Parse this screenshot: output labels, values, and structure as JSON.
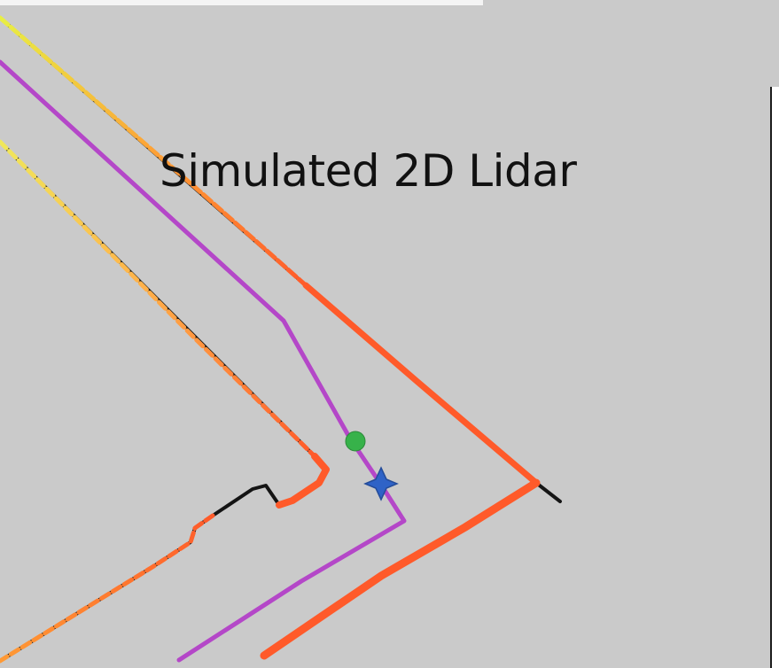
{
  "title": "Simulated 2D Lidar",
  "colors": {
    "background": "#cacaca",
    "wall": "#111111",
    "scan_near": "#ff5a2a",
    "scan_mid": "#ff9a35",
    "scan_far": "#e8ef44",
    "path": "#b447c8",
    "goal_marker": "#37b24a",
    "robot_marker": "#2f63c7"
  },
  "icons": {
    "goal": "green-dot-goal-icon",
    "robot": "blue-robot-icon"
  }
}
